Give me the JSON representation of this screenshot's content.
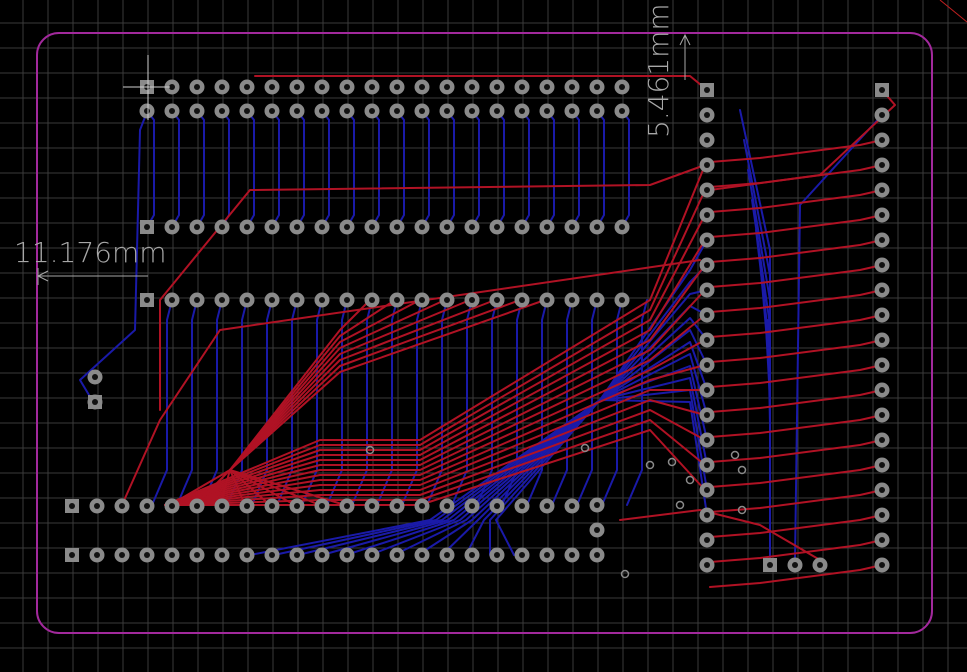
{
  "view": {
    "background_color": "#000000",
    "grid_color": "#3a3a3a",
    "outline_color": "#a2299c",
    "top_layer_color": "#b01224",
    "bottom_layer_color": "#1a1aa8",
    "pad_color": "#8a8a8a",
    "dimension_color": "#a7a7a7"
  },
  "dimensions": {
    "horizontal": "11.176mm",
    "vertical": "5.461mm"
  },
  "components": {
    "top_header_rows": [
      20,
      20
    ],
    "mid_header_rows": [
      20,
      20
    ],
    "bottom_header_rows": [
      21,
      22
    ],
    "right_column_a_pins": 20,
    "right_column_b_pins": 20,
    "left_connector_pins": 2,
    "bottom_right_connector_pins": 3
  }
}
